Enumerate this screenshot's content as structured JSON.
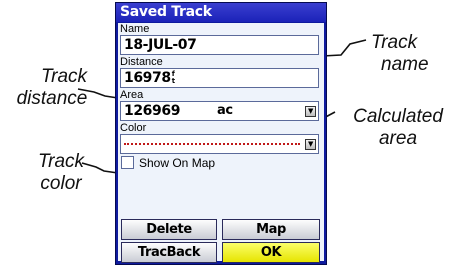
{
  "window": {
    "title": "Saved Track"
  },
  "fields": {
    "name": {
      "label": "Name",
      "value": "18-JUL-07"
    },
    "distance": {
      "label": "Distance",
      "value": "16978",
      "unit_top": "f",
      "unit_bottom": "t"
    },
    "area": {
      "label": "Area",
      "value": "126969",
      "unit": "ac"
    },
    "color": {
      "label": "Color",
      "line_color": "#c01818"
    }
  },
  "show_on_map": {
    "label": "Show On Map",
    "checked": false
  },
  "buttons": {
    "delete": "Delete",
    "map": "Map",
    "trackback": "TracBack",
    "ok": "OK"
  },
  "callouts": {
    "track_name": [
      "Track",
      "name"
    ],
    "track_distance": [
      "Track",
      "distance"
    ],
    "calculated_area": [
      "Calculated",
      "area"
    ],
    "track_color": [
      "Track",
      "color"
    ]
  },
  "colors": {
    "frame": "#0e1a9e",
    "title_bar": "#1b22b8",
    "screen_bg": "#eef3fb",
    "selected_button": "#e6e400"
  },
  "icons": {
    "dropdown": "chevron-down-icon",
    "checkbox": "checkbox-empty-icon"
  }
}
